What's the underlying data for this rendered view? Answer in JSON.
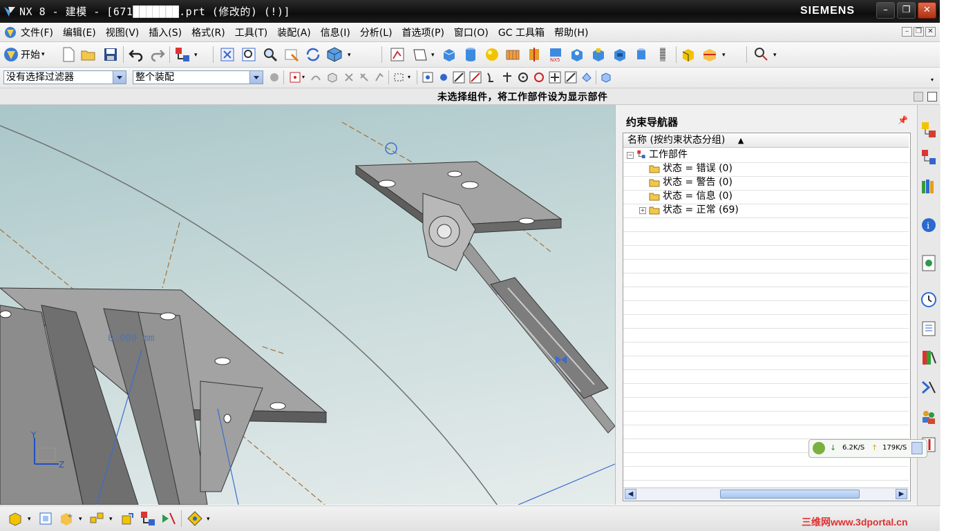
{
  "window": {
    "title": "NX 8 - 建模 - [671███████.prt  (修改的)     (!)]",
    "brand": "SIEMENS",
    "controls": [
      "minimize",
      "restore",
      "close"
    ]
  },
  "menubar": {
    "items": [
      "文件(F)",
      "编辑(E)",
      "视图(V)",
      "插入(S)",
      "格式(R)",
      "工具(T)",
      "装配(A)",
      "信息(I)",
      "分析(L)",
      "首选项(P)",
      "窗口(O)",
      "GC 工具箱",
      "帮助(H)"
    ]
  },
  "toolbar": {
    "start_label": "开始"
  },
  "selection_bar": {
    "filter_value": "没有选择过滤器",
    "scope_value": "整个装配"
  },
  "status": {
    "message": "未选择组件，将工作部件设为显示部件"
  },
  "viewport": {
    "dimension_label": "0.000 mm",
    "axis_labels": [
      "Y",
      "Z"
    ]
  },
  "navigator": {
    "title": "约束导航器",
    "column_header": "名称 (按约束状态分组)",
    "sort_glyph": "▲",
    "root": "工作部件",
    "groups": [
      {
        "label": "状态 = 错误 (0)",
        "expandable": false
      },
      {
        "label": "状态 = 警告 (0)",
        "expandable": false
      },
      {
        "label": "状态 = 信息 (0)",
        "expandable": false
      },
      {
        "label": "状态 = 正常 (69)",
        "expandable": true
      }
    ]
  },
  "netmonitor": {
    "down": "6.2K/S",
    "up": "179K/S"
  },
  "watermark": "三维网www.3dportal.cn"
}
